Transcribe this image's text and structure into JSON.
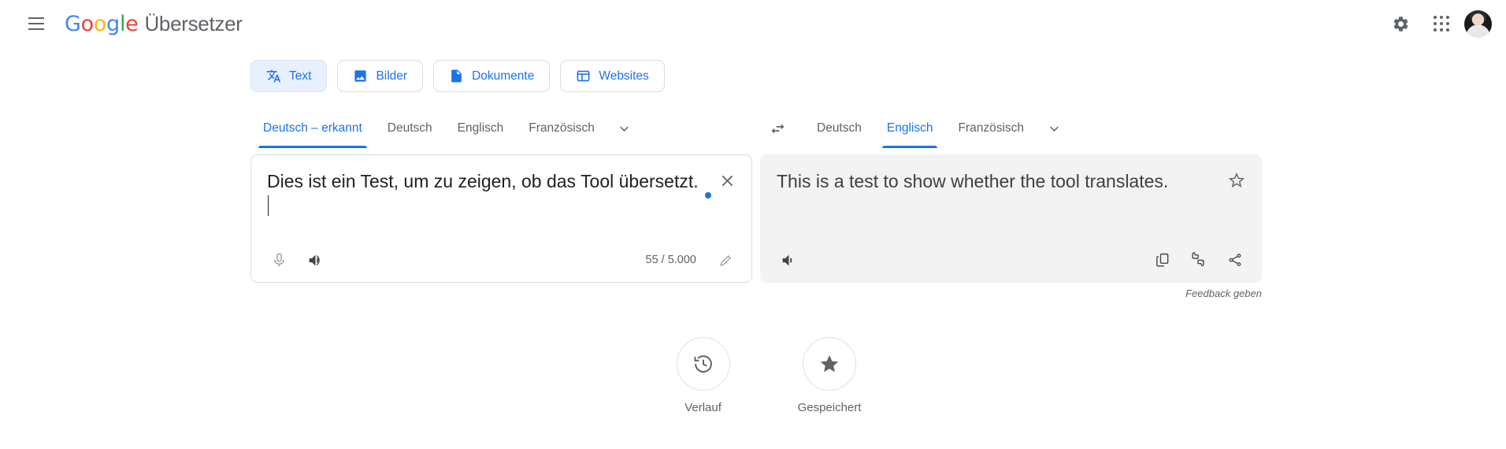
{
  "header": {
    "menu_icon": "hamburger-menu-icon",
    "logo_letters": [
      "G",
      "o",
      "o",
      "g",
      "l",
      "e"
    ],
    "product_name": "Übersetzer",
    "settings_icon": "gear-icon",
    "apps_icon": "apps-grid-icon",
    "avatar_icon": "user-avatar"
  },
  "mode_tabs": [
    {
      "label": "Text",
      "icon": "translate-icon",
      "active": true
    },
    {
      "label": "Bilder",
      "icon": "image-icon",
      "active": false
    },
    {
      "label": "Dokumente",
      "icon": "document-icon",
      "active": false
    },
    {
      "label": "Websites",
      "icon": "website-icon",
      "active": false
    }
  ],
  "source_languages": [
    {
      "label": "Deutsch – erkannt",
      "active": true
    },
    {
      "label": "Deutsch",
      "active": false
    },
    {
      "label": "Englisch",
      "active": false
    },
    {
      "label": "Französisch",
      "active": false
    }
  ],
  "target_languages": [
    {
      "label": "Deutsch",
      "active": false
    },
    {
      "label": "Englisch",
      "active": true
    },
    {
      "label": "Französisch",
      "active": false
    }
  ],
  "swap_icon": "swap-languages-icon",
  "more_languages_icon": "chevron-down-icon",
  "source_panel": {
    "text": "Dies ist ein Test, um zu zeigen, ob das Tool übersetzt.",
    "clear_icon": "close-icon",
    "mic_icon": "microphone-icon",
    "speaker_icon": "speaker-icon",
    "char_count": "55 / 5.000",
    "edit_icon": "pencil-icon"
  },
  "target_panel": {
    "text": "This is a test to show whether the tool translates.",
    "star_icon": "star-outline-icon",
    "speaker_icon": "speaker-icon",
    "copy_icon": "copy-icon",
    "rate_icon": "thumbs-up-down-icon",
    "share_icon": "share-icon"
  },
  "feedback_label": "Feedback geben",
  "bottom_actions": [
    {
      "label": "Verlauf",
      "icon": "history-clock-icon"
    },
    {
      "label": "Gespeichert",
      "icon": "star-filled-icon"
    }
  ],
  "colors": {
    "accent": "#1a73e8",
    "accent_bg": "#e8f0fe",
    "panel_bg": "#f3f3f3",
    "text": "#202124",
    "muted": "#5f6368",
    "border": "#dadce0"
  }
}
